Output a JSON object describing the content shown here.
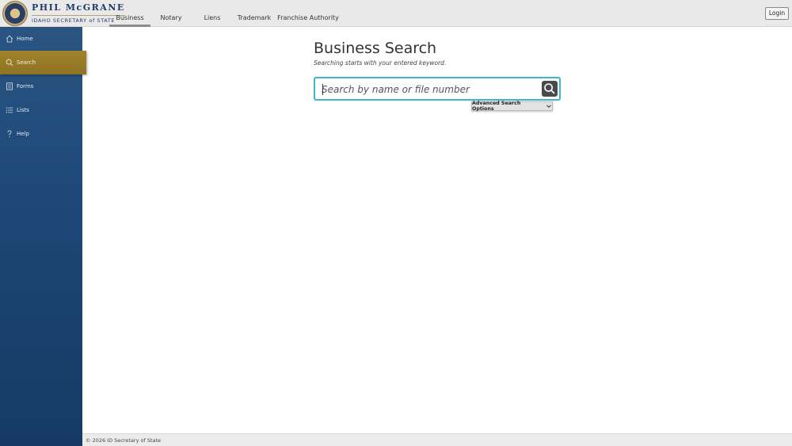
{
  "brand": {
    "name": "PHIL McGRANE",
    "subtitle": "IDAHO SECRETARY of STATE"
  },
  "topnav": {
    "items": [
      {
        "label": "Business",
        "active": true
      },
      {
        "label": "Notary",
        "active": false
      },
      {
        "label": "Liens",
        "active": false
      },
      {
        "label": "Trademark",
        "active": false
      },
      {
        "label": "Franchise Authority",
        "active": false
      }
    ]
  },
  "header": {
    "login_label": "Login"
  },
  "sidebar": {
    "items": [
      {
        "label": "Home",
        "icon": "home-icon",
        "active": false
      },
      {
        "label": "Search",
        "icon": "search-icon",
        "active": true
      },
      {
        "label": "Forms",
        "icon": "forms-icon",
        "active": false
      },
      {
        "label": "Lists",
        "icon": "list-icon",
        "active": false
      },
      {
        "label": "Help",
        "icon": "help-icon",
        "active": false
      }
    ]
  },
  "main": {
    "title": "Business Search",
    "subtitle": "Searching starts with your entered keyword.",
    "search": {
      "placeholder": "Search by name or file number",
      "value": ""
    },
    "advanced_label": "Advanced Search Options"
  },
  "footer": {
    "text": "© 2026 ID Secretary of State"
  },
  "colors": {
    "sidebar": "#1d4878",
    "active_nav": "#a0832a",
    "search_border": "#3bb7d2",
    "search_button": "#4a4a4a"
  }
}
